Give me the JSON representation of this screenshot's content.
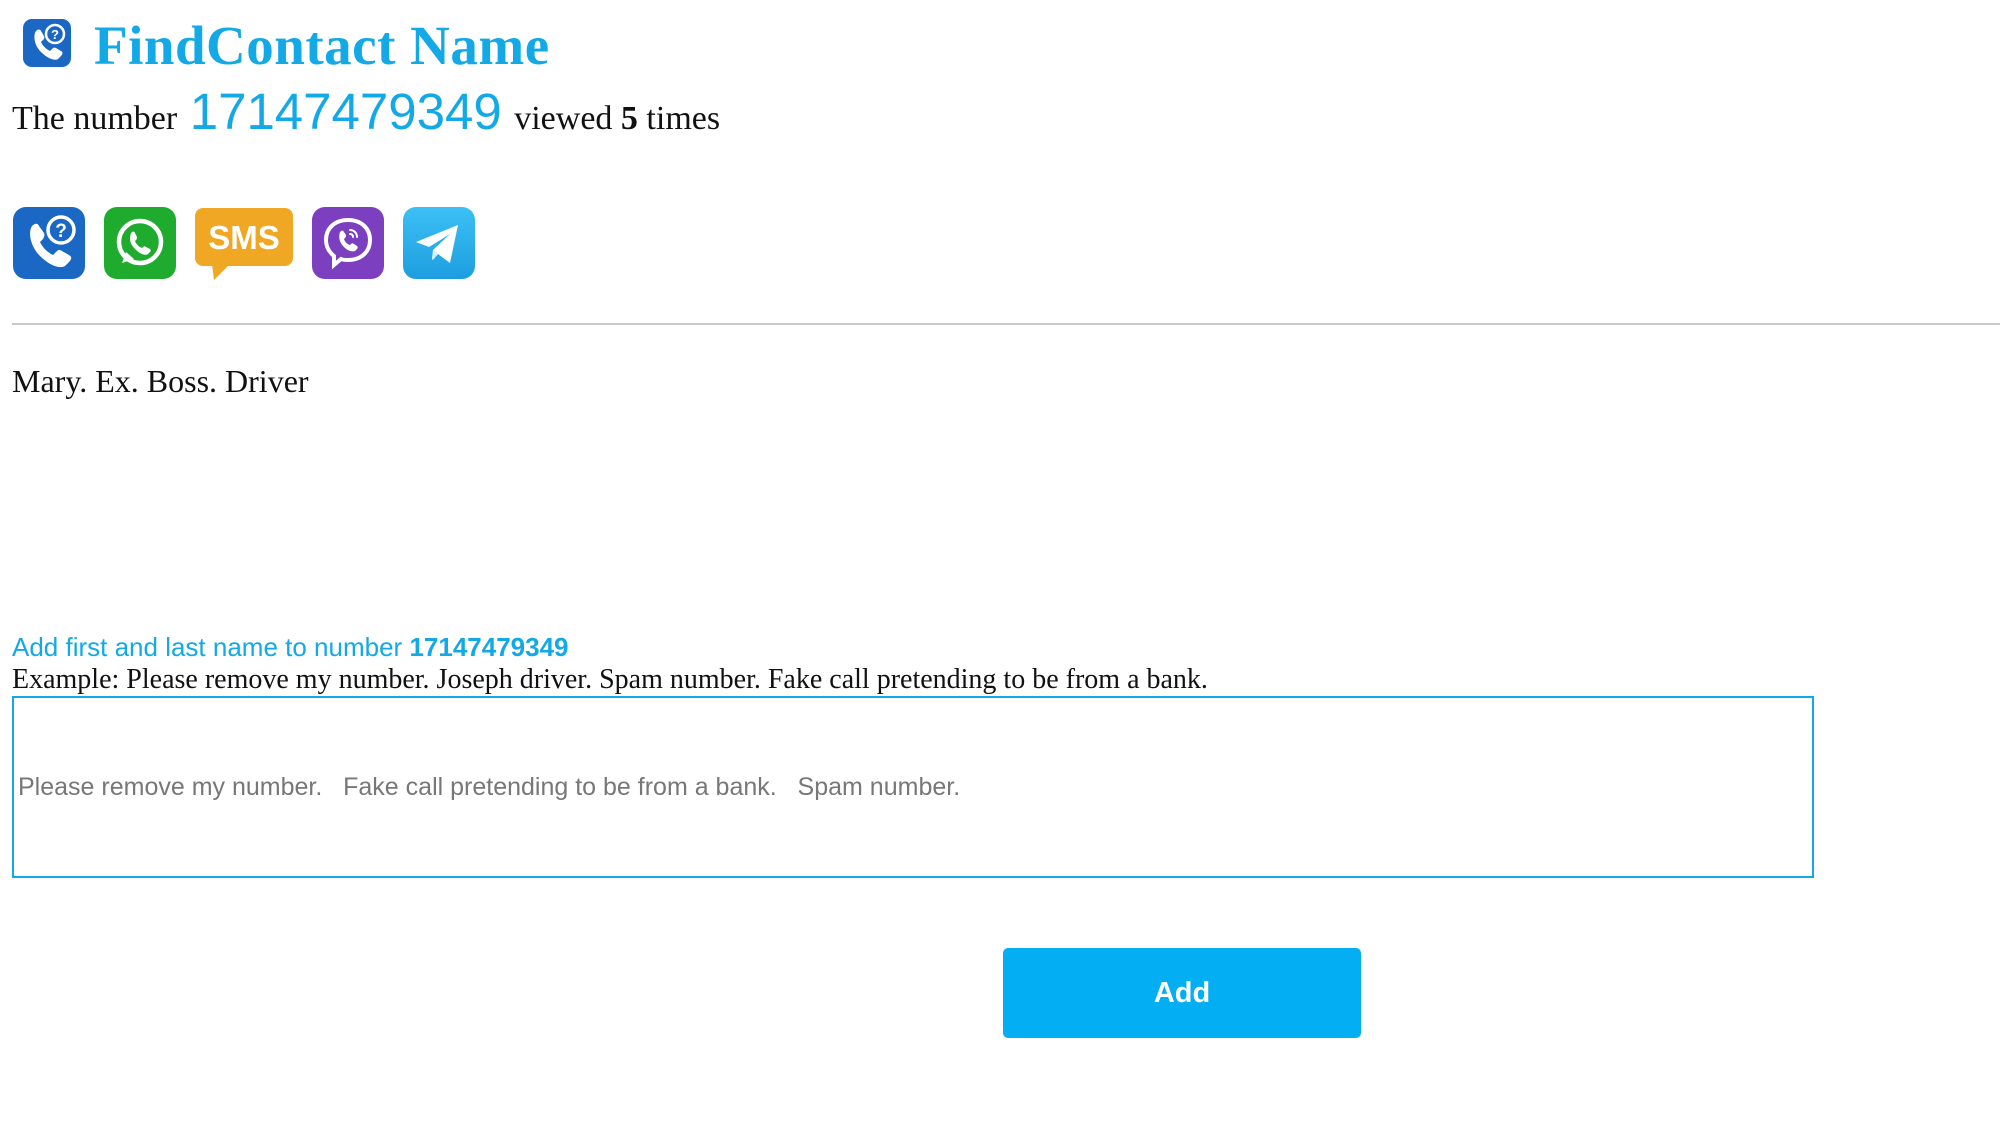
{
  "header": {
    "title": "FindContact Name",
    "logo_icon": "phone-question-icon"
  },
  "views": {
    "prefix": "The number",
    "number": "17147479349",
    "middle": "viewed",
    "count": "5",
    "suffix": "times"
  },
  "apps": [
    {
      "name": "Phone",
      "icon": "phone-question-icon",
      "color": "#1a67c4"
    },
    {
      "name": "WhatsApp",
      "icon": "whatsapp-icon",
      "color": "#1fab2e"
    },
    {
      "name": "SMS",
      "label": "SMS",
      "icon": "sms-icon",
      "color": "#f0a824"
    },
    {
      "name": "Viber",
      "icon": "viber-icon",
      "color": "#7b3fbf"
    },
    {
      "name": "Telegram",
      "icon": "telegram-icon",
      "color": "#29a9eb"
    }
  ],
  "comment": "Mary. Ex. Boss. Driver",
  "add_form": {
    "prompt": "Add first and last name to number",
    "number": "17147479349",
    "example": "Example: Please remove my number. Joseph driver. Spam number. Fake call pretending to be from a bank.",
    "placeholder": "Please remove my number.   Fake call pretending to be from a bank.   Spam number.",
    "button_label": "Add"
  },
  "colors": {
    "accent": "#13a9e6",
    "button": "#03aef2"
  }
}
